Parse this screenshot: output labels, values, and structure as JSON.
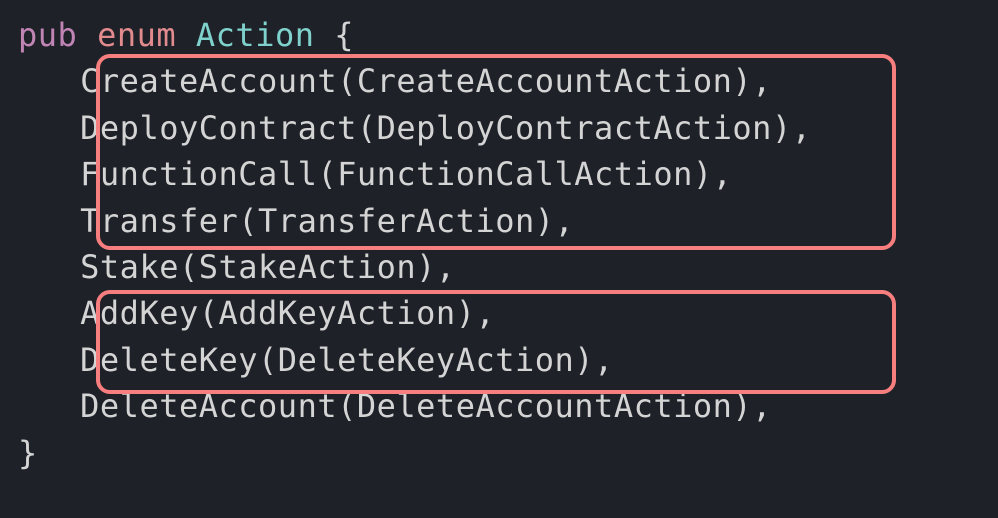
{
  "code": {
    "kw_pub": "pub",
    "kw_enum": "enum",
    "type_name": "Action",
    "open_brace": " {",
    "close_brace": "}",
    "variants": [
      {
        "name": "CreateAccount",
        "inner": "CreateAccountAction"
      },
      {
        "name": "DeployContract",
        "inner": "DeployContractAction"
      },
      {
        "name": "FunctionCall",
        "inner": "FunctionCallAction"
      },
      {
        "name": "Transfer",
        "inner": "TransferAction"
      },
      {
        "name": "Stake",
        "inner": "StakeAction"
      },
      {
        "name": "AddKey",
        "inner": "AddKeyAction"
      },
      {
        "name": "DeleteKey",
        "inner": "DeleteKeyAction"
      },
      {
        "name": "DeleteAccount",
        "inner": "DeleteAccountAction"
      }
    ]
  }
}
